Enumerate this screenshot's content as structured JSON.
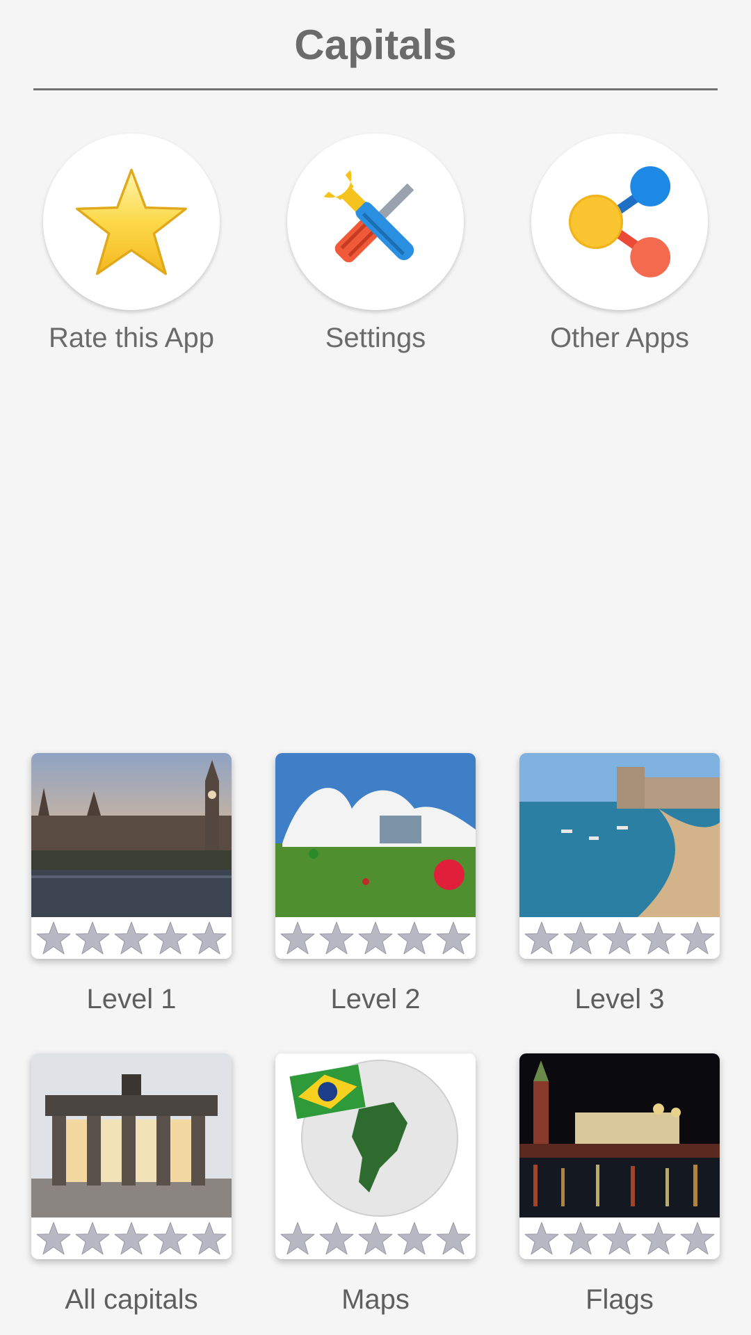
{
  "header": {
    "title": "Capitals"
  },
  "actions": [
    {
      "label": "Rate this App",
      "icon": "star-icon"
    },
    {
      "label": "Settings",
      "icon": "tools-icon"
    },
    {
      "label": "Other Apps",
      "icon": "share-icon"
    }
  ],
  "levels": [
    {
      "label": "Level 1",
      "image": "london-thumbnail",
      "stars": 0
    },
    {
      "label": "Level 2",
      "image": "baku-thumbnail",
      "stars": 0
    },
    {
      "label": "Level 3",
      "image": "mogadishu-thumbnail",
      "stars": 0
    },
    {
      "label": "All capitals",
      "image": "berlin-thumbnail",
      "stars": 0
    },
    {
      "label": "Maps",
      "image": "brazil-globe-thumbnail",
      "stars": 0
    },
    {
      "label": "Flags",
      "image": "moscow-thumbnail",
      "stars": 0
    }
  ],
  "colors": {
    "background": "#f5f5f5",
    "star_empty": "#b8b8c4",
    "rate_star": "#f7c52c"
  }
}
